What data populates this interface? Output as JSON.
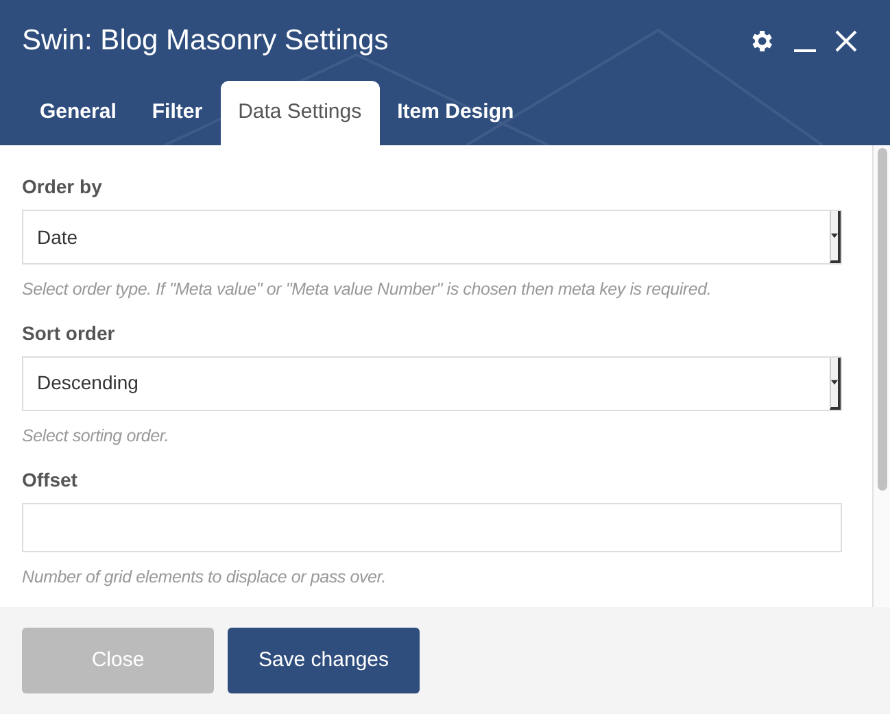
{
  "window": {
    "title": "Swin: Blog Masonry Settings"
  },
  "tabs": [
    {
      "label": "General",
      "selected": false
    },
    {
      "label": "Filter",
      "selected": false
    },
    {
      "label": "Data Settings",
      "selected": true
    },
    {
      "label": "Item Design",
      "selected": false
    }
  ],
  "fields": [
    {
      "kind": "select",
      "label": "Order by",
      "value": "Date",
      "hint": "Select order type. If \"Meta value\" or \"Meta value Number\" is chosen then meta key is required."
    },
    {
      "kind": "select",
      "label": "Sort order",
      "value": "Descending",
      "hint": "Select sorting order."
    },
    {
      "kind": "text",
      "label": "Offset",
      "hint": "Number of grid elements to displace or pass over."
    }
  ],
  "buttons": [
    {
      "kind": "secondary",
      "label": "Close"
    },
    {
      "kind": "primary",
      "label": "Save changes"
    }
  ]
}
